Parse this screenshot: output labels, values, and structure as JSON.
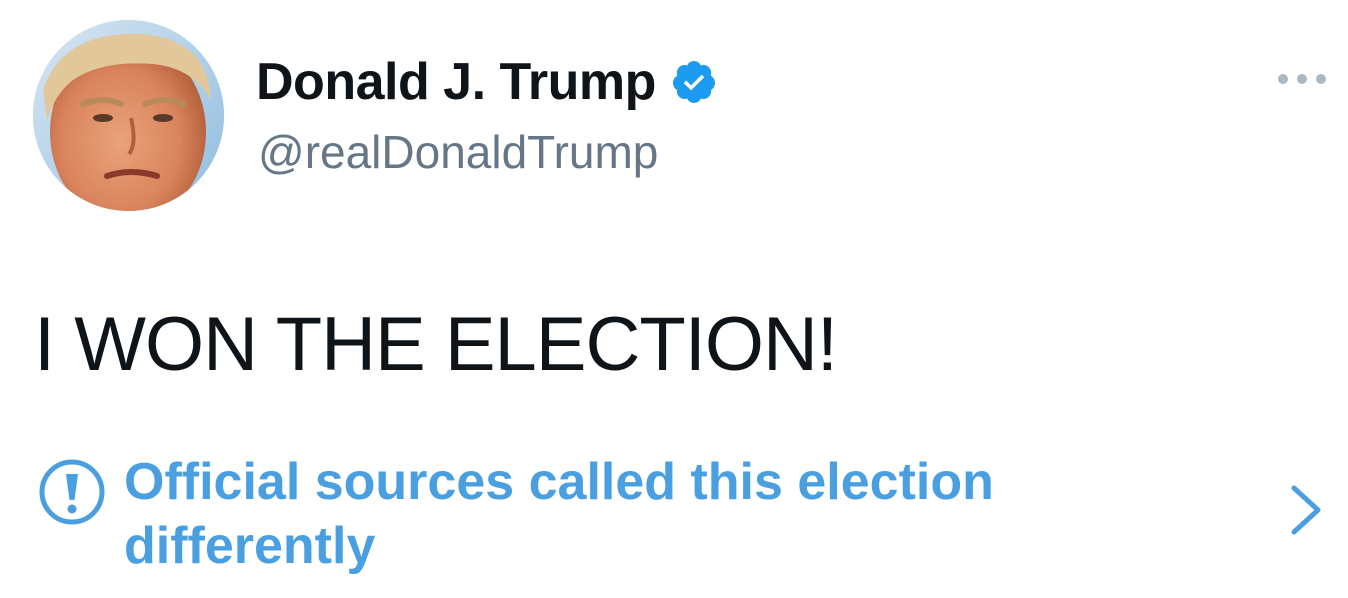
{
  "author": {
    "display_name": "Donald J. Trump",
    "handle": "@realDonaldTrump",
    "verified": true
  },
  "tweet": {
    "text": "I WON THE ELECTION!"
  },
  "notice": {
    "text": "Official sources called this election differently"
  },
  "icons": {
    "avatar": "profile-photo",
    "verified": "verified-badge-icon",
    "more": "more-options-icon",
    "notice": "exclamation-circle-icon",
    "chevron": "chevron-right-icon"
  },
  "colors": {
    "text": "#0f1419",
    "handle": "#657786",
    "accent": "#4a9fe0",
    "verified": "#1d9bf0",
    "more_dots": "#aab8c2"
  }
}
